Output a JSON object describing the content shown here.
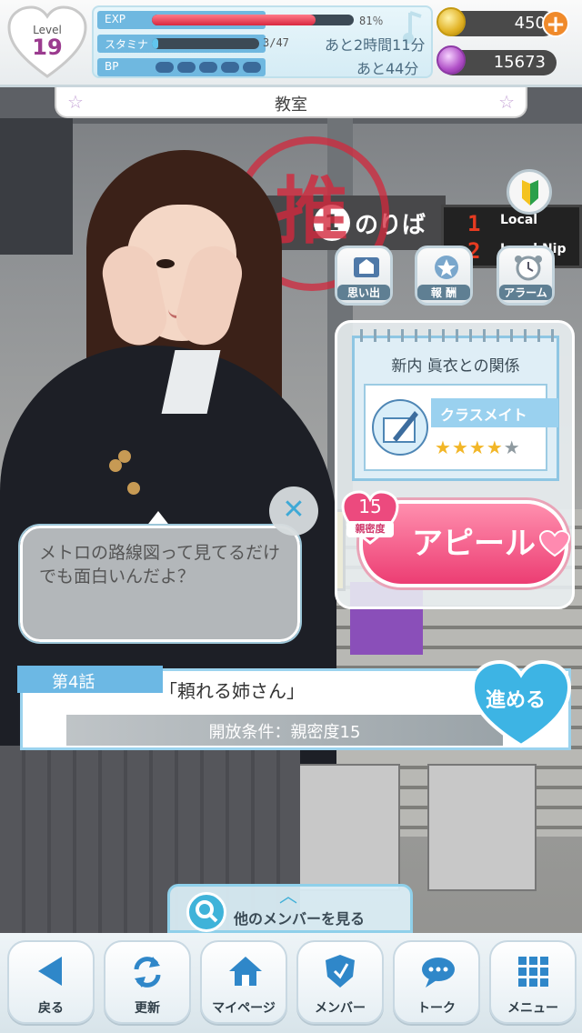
{
  "hud": {
    "level_label": "Level",
    "level": "19",
    "exp": {
      "label": "EXP",
      "value": "81％",
      "fill": 0.81
    },
    "stamina": {
      "label": "スタミナ",
      "value": "3/47",
      "recovery": "あと2時間11分",
      "fill": 0.06
    },
    "bp": {
      "label": "BP",
      "pips_filled": 0,
      "pips_total": 5,
      "recovery": "あと44分"
    },
    "coins": "450",
    "gems": "15673"
  },
  "location": {
    "title": "教室"
  },
  "scene": {
    "stamp_char": "推",
    "platform_sign": "のりば",
    "board_num1": "1",
    "board_num2": "2",
    "board_text1": "Local",
    "board_text2": "Local Nip"
  },
  "side_buttons": [
    {
      "label": "思い出",
      "icon": "album-icon"
    },
    {
      "label": "報 酬",
      "icon": "reward-icon"
    },
    {
      "label": "アラーム",
      "icon": "alarm-clock-icon"
    }
  ],
  "relationship": {
    "title": "新内 眞衣との関係",
    "rank": "クラスメイト",
    "stars_filled": 4,
    "stars_total": 5,
    "intimacy_value": "15",
    "intimacy_label": "親密度",
    "appeal_label": "アピール"
  },
  "dialogue": {
    "text": "メトロの路線図って見てるだけでも面白いんだよ？",
    "close_symbol": "✕"
  },
  "episode": {
    "number_label": "第4話",
    "title": "「頼れる姉さん」",
    "condition": "開放条件：親密度15",
    "proceed_label": "進める"
  },
  "other_members": {
    "label": "他のメンバーを見る"
  },
  "nav": [
    {
      "label": "戻る",
      "icon": "back-arrow-icon"
    },
    {
      "label": "更新",
      "icon": "refresh-icon"
    },
    {
      "label": "マイページ",
      "icon": "home-icon"
    },
    {
      "label": "メンバー",
      "icon": "member-shield-icon"
    },
    {
      "label": "トーク",
      "icon": "chat-bubble-icon"
    },
    {
      "label": "メニュー",
      "icon": "menu-grid-icon"
    }
  ],
  "colors": {
    "accent_blue": "#6cb8e4",
    "appeal_pink": "#ec3d73",
    "exp_red": "#e0354a",
    "star_gold": "#f2b627"
  }
}
